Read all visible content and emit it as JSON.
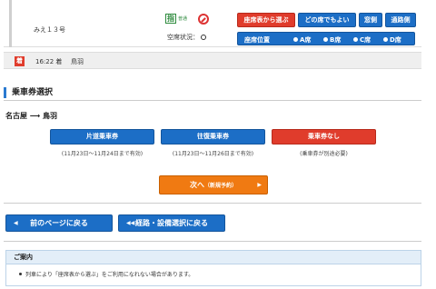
{
  "train": {
    "name": "みえ１３号",
    "seat_icon_glyph": "指",
    "seat_type": "普通",
    "vacancy_label": "空席状況：",
    "buttons": {
      "seat_map": "座席表から選ぶ",
      "any_seat": "どの席でもよい",
      "window": "窓側",
      "aisle": "通路側"
    },
    "seat_position": {
      "label": "座席位置",
      "options": [
        "A席",
        "B席",
        "C席",
        "D席"
      ]
    }
  },
  "arrival": {
    "badge": "着",
    "time": "16:22 着",
    "station": "鳥羽"
  },
  "ticket_section": {
    "title": "乗車券選択",
    "route": "名古屋 ⟶ 鳥羽",
    "options": [
      {
        "label": "片道乗車券",
        "note": "(11月23日～11月24日まで有効)"
      },
      {
        "label": "往復乗車券",
        "note": "(11月23日～11月26日まで有効)"
      },
      {
        "label": "乗車券なし",
        "note": "(乗車券が別途必要)"
      }
    ]
  },
  "next_button": {
    "label": "次へ",
    "sub": "（新規予約）",
    "arrow": "▶"
  },
  "nav": {
    "back_label": "前のページに戻る",
    "back_icon": "◀",
    "route_label": "経路・設備選択に戻る",
    "route_icon": "◀◀"
  },
  "notice": {
    "title": "ご案内",
    "items": [
      "列車により「座席表から選ぶ」をご利用になれない場合があります。"
    ]
  },
  "colors": {
    "accent_blue": "#1c6ec6",
    "accent_red": "#e03c2c",
    "accent_orange": "#f07a12"
  }
}
